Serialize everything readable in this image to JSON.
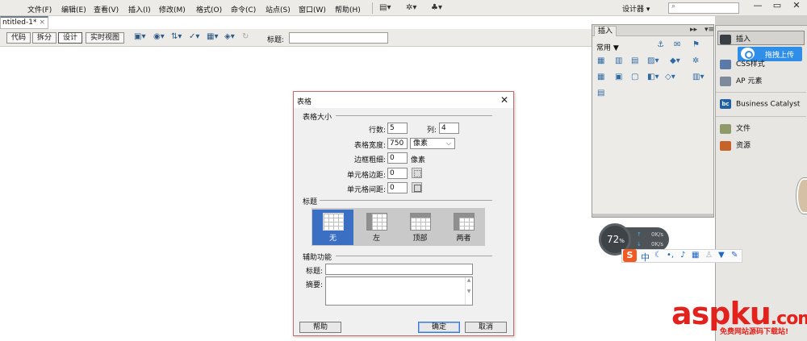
{
  "menubar": {
    "items": [
      "文件(F)",
      "编辑(E)",
      "查看(V)",
      "插入(I)",
      "修改(M)",
      "格式(O)",
      "命令(C)",
      "站点(S)",
      "窗口(W)",
      "帮助(H)"
    ],
    "workspace": "设计器",
    "search_placeholder": ""
  },
  "document": {
    "tab_label": "ntitled-1*",
    "views": [
      "代码",
      "拆分",
      "设计",
      "实时视图"
    ],
    "title_label": "标题:",
    "title_value": ""
  },
  "insert_panel": {
    "tab": "插入",
    "category": "常用"
  },
  "dock": {
    "items": [
      "插入",
      "CSS样式",
      "AP 元素",
      "Business Catalyst",
      "文件",
      "资源"
    ],
    "tooltip": "拖拽上传"
  },
  "net_meter": {
    "percent": "72",
    "percent_sign": "%",
    "up_rate": "0K/s",
    "down_rate": "0K/s"
  },
  "ime": {
    "logo": "S",
    "mode": "中"
  },
  "dialog": {
    "title": "表格",
    "section_size": "表格大小",
    "rows_label": "行数:",
    "rows_value": "5",
    "cols_label": "列:",
    "cols_value": "4",
    "width_label": "表格宽度:",
    "width_value": "750",
    "width_unit": "像素",
    "border_label": "边框粗细:",
    "border_value": "0",
    "border_unit": "像素",
    "padding_label": "单元格边距:",
    "padding_value": "0",
    "spacing_label": "单元格间距:",
    "spacing_value": "0",
    "section_header": "标题",
    "header_options": [
      "无",
      "左",
      "顶部",
      "两者"
    ],
    "header_selected": "无",
    "section_access": "辅助功能",
    "caption_label": "标题:",
    "caption_value": "",
    "summary_label": "摘要:",
    "summary_value": "",
    "help_button": "帮助",
    "ok_button": "确定",
    "cancel_button": "取消"
  },
  "watermark": {
    "brand": "aspku",
    "suffix": ".com",
    "tagline": "免费网站源码下载站!"
  }
}
